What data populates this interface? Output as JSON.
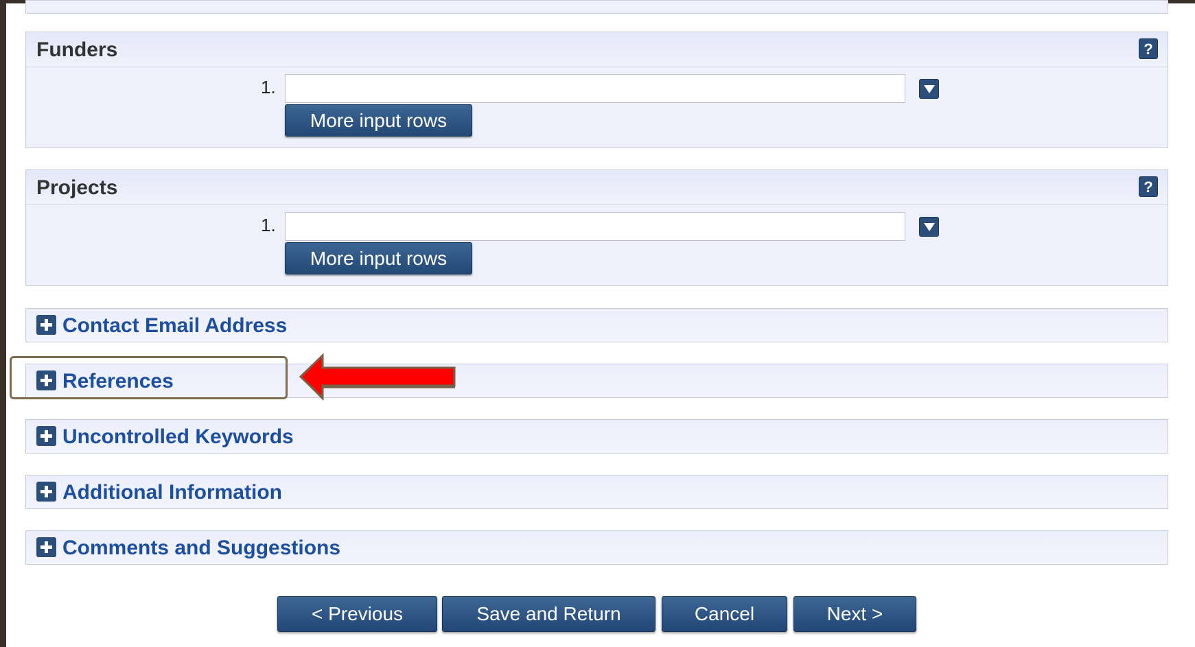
{
  "funders": {
    "title": "Funders",
    "help_label": "?",
    "row_number": "1.",
    "input_value": "",
    "more_rows_label": "More input rows"
  },
  "projects": {
    "title": "Projects",
    "help_label": "?",
    "row_number": "1.",
    "input_value": "",
    "more_rows_label": "More input rows"
  },
  "collapsed_sections": [
    "Contact Email Address",
    "References",
    "Uncontrolled Keywords",
    "Additional Information",
    "Comments and Suggestions"
  ],
  "navigation": {
    "previous": "< Previous",
    "save_return": "Save and Return",
    "cancel": "Cancel",
    "next": "Next >"
  },
  "colors": {
    "arrow": "#ff0000",
    "highlight_border": "#7d6a4f",
    "section_title": "#1d4fa0",
    "button": "#2b4f7a"
  }
}
